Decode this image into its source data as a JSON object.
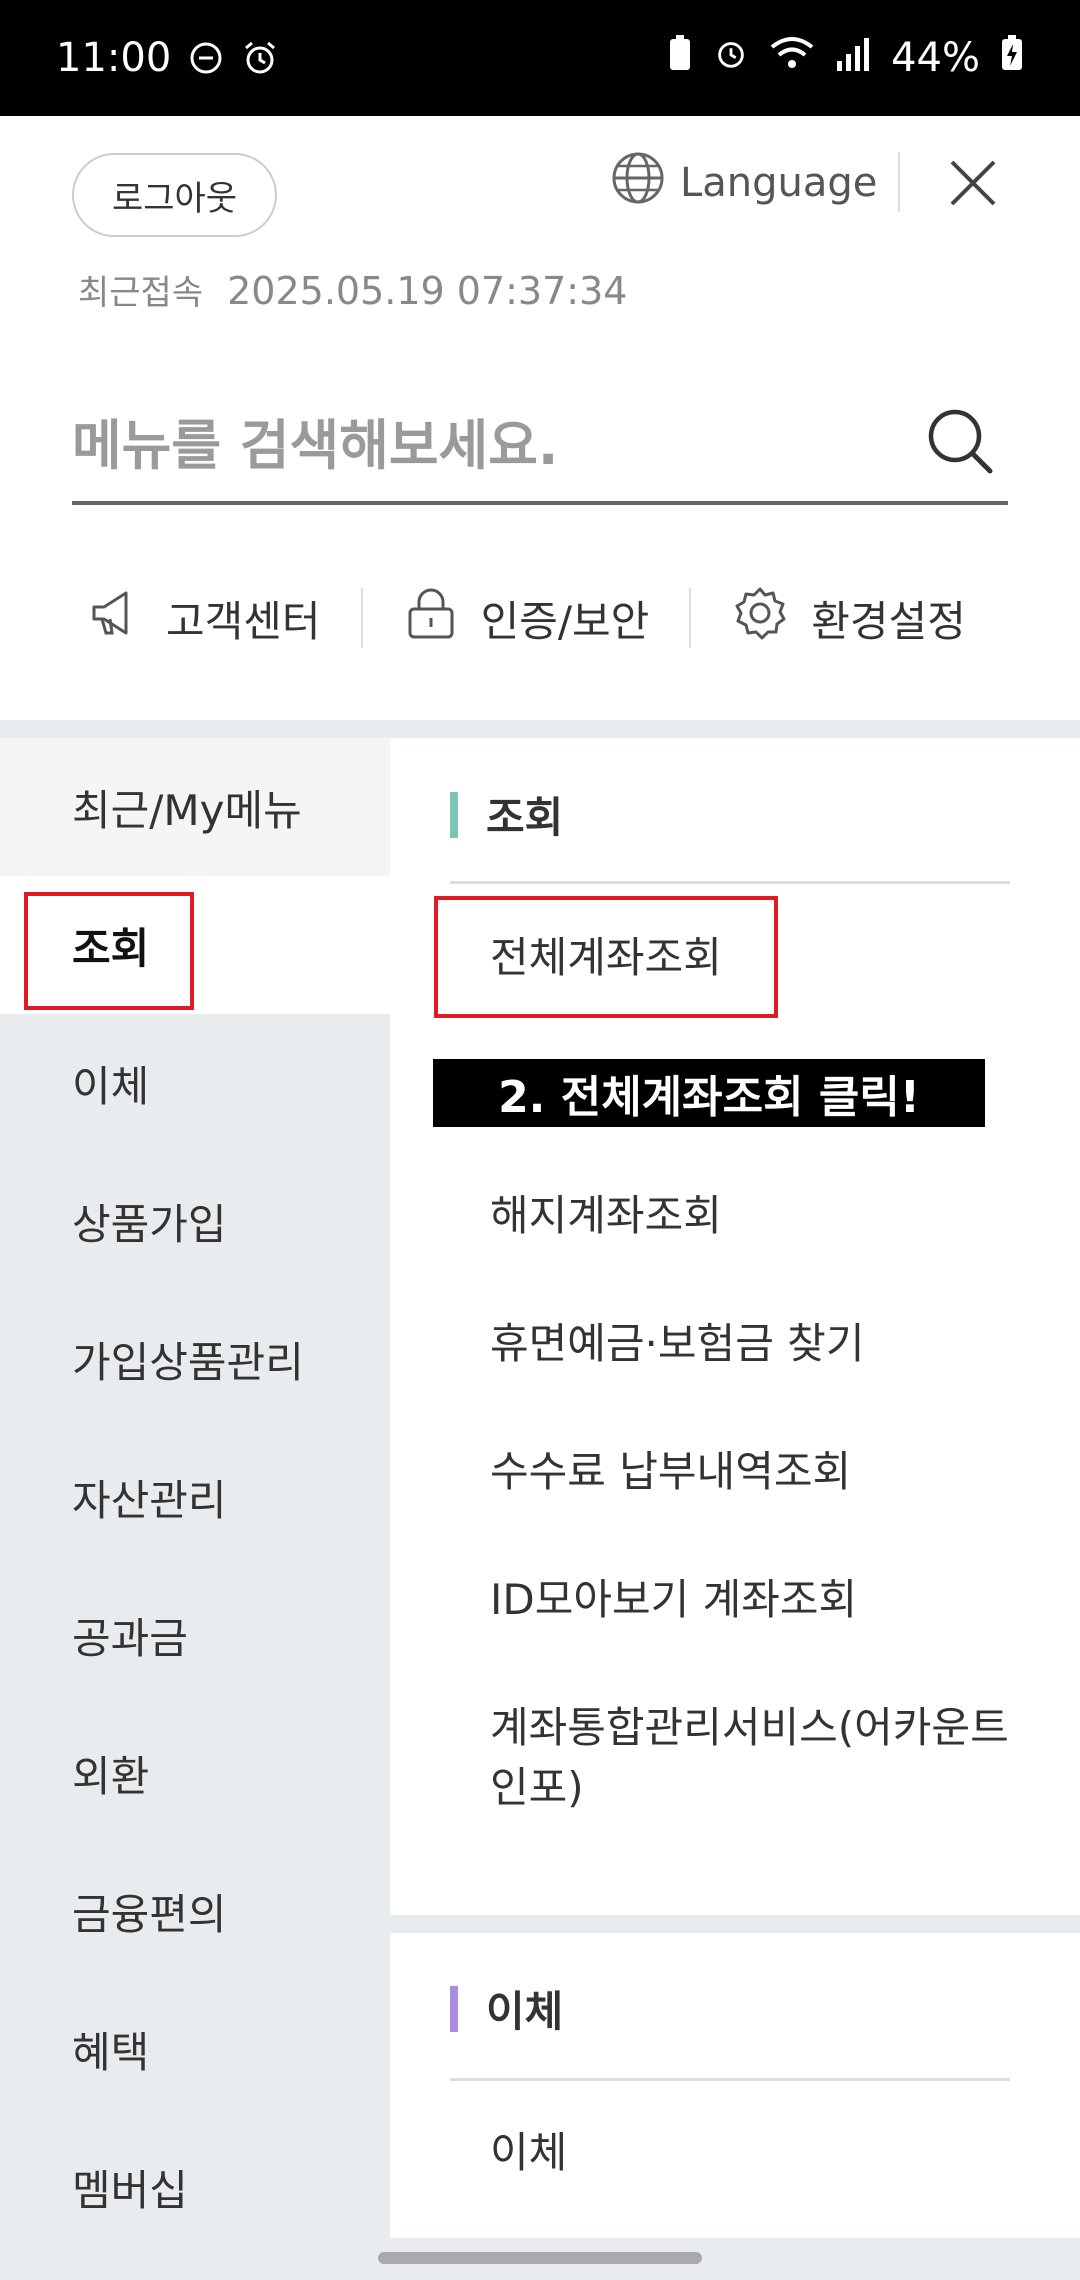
{
  "status_bar": {
    "time": "11:00",
    "battery": "44%"
  },
  "header": {
    "logout_label": "로그아웃",
    "language_label": "Language",
    "recent_login_label": "최근접속",
    "recent_login_time": "2025.05.19 07:37:34"
  },
  "search": {
    "placeholder": "메뉴를 검색해보세요."
  },
  "quick_links": [
    {
      "label": "고객센터",
      "icon": "megaphone-icon"
    },
    {
      "label": "인증/보안",
      "icon": "lock-icon"
    },
    {
      "label": "환경설정",
      "icon": "gear-icon"
    }
  ],
  "nav": {
    "items": [
      "최근/My메뉴",
      "조회",
      "이체",
      "상품가입",
      "가입상품관리",
      "자산관리",
      "공과금",
      "외환",
      "금융편의",
      "혜택",
      "멤버십"
    ],
    "active": "조회"
  },
  "sections": [
    {
      "title": "조회",
      "accent": "#7cc4b4",
      "items": [
        "전체계좌조회",
        "해지계좌조회",
        "휴면예금·보험금 찾기",
        "수수료 납부내역조회",
        "ID모아보기 계좌조회",
        "계좌통합관리서비스(어카운트인포)"
      ]
    },
    {
      "title": "이체",
      "accent": "#a98ee0",
      "items": [
        "이체"
      ]
    }
  ],
  "annotation": {
    "text": "2. 전체계좌조회 클릭!"
  }
}
